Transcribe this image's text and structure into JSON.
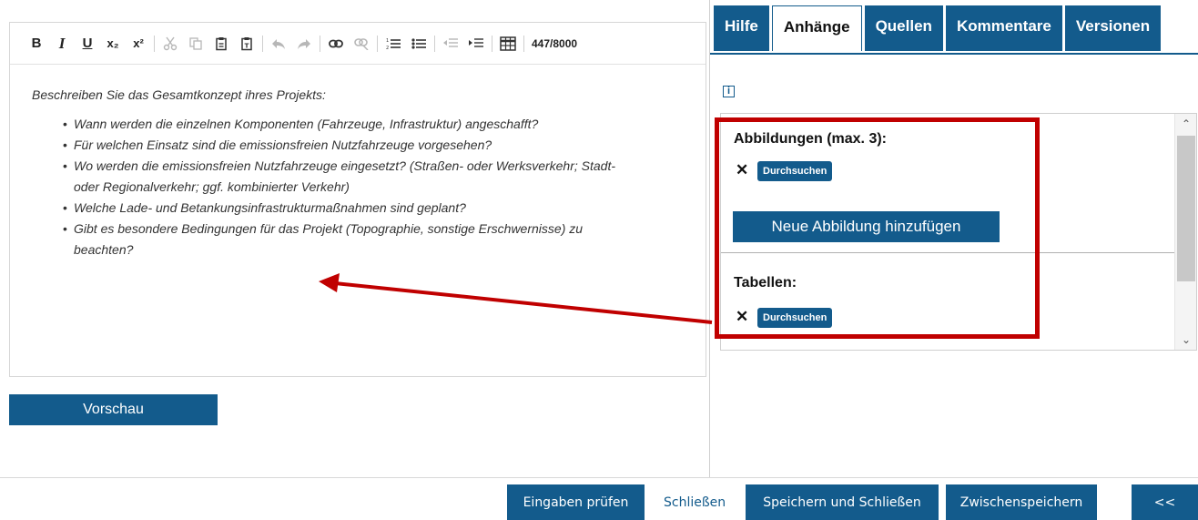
{
  "toolbar": {
    "bold": "B",
    "italic": "I",
    "underline": "U",
    "subscript": "x₂",
    "superscript": "x²",
    "char_count": "447/8000"
  },
  "editor": {
    "intro": "Beschreiben Sie das Gesamtkonzept ihres Projekts:",
    "items": [
      "Wann werden die einzelnen Komponenten (Fahrzeuge, Infrastruktur) angeschafft?",
      "Für welchen Einsatz sind die emissionsfreien Nutzfahrzeuge vorgesehen?",
      "Wo werden die emissionsfreien Nutzfahrzeuge eingesetzt? (Straßen- oder Werksverkehr; Stadt- oder Regionalverkehr; ggf. kombinierter Verkehr)",
      "Welche Lade- und Betankungsinfrastrukturmaßnahmen sind geplant?",
      "Gibt es besondere Bedingungen für das Projekt (Topographie, sonstige Erschwernisse) zu beachten?"
    ]
  },
  "preview_label": "Vorschau",
  "tabs": [
    "Hilfe",
    "Anhänge",
    "Quellen",
    "Kommentare",
    "Versionen"
  ],
  "active_tab": "Anhänge",
  "attachments": {
    "images_title": "Abbildungen (max. 3):",
    "remove_symbol": "✕",
    "browse_label": "Durchsuchen",
    "add_image_label": "Neue Abbildung hinzufügen",
    "tables_title": "Tabellen:"
  },
  "bottom": {
    "check": "Eingaben prüfen",
    "close": "Schließen",
    "save_close": "Speichern und Schließen",
    "save_temp": "Zwischenspeichern",
    "collapse": "<<"
  },
  "colors": {
    "primary": "#135b8c",
    "highlight": "#c00000"
  }
}
